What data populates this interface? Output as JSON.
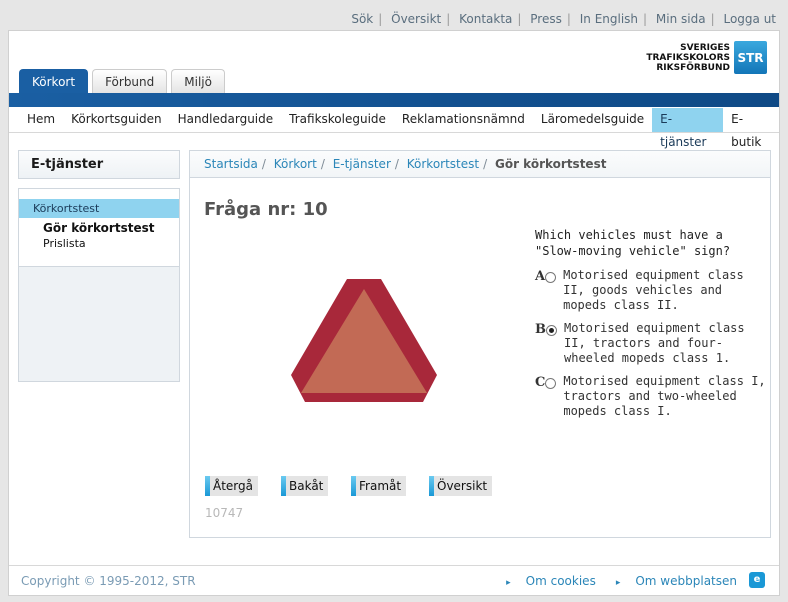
{
  "top_links": [
    "Sök",
    "Översikt",
    "Kontakta",
    "Press",
    "In English",
    "Min sida",
    "Logga ut"
  ],
  "header": {
    "tabs": [
      {
        "label": "Körkort",
        "active": true
      },
      {
        "label": "Förbund",
        "active": false
      },
      {
        "label": "Miljö",
        "active": false
      }
    ],
    "logo_line1": "SVERIGES",
    "logo_line2": "TRAFIKSKOLORS",
    "logo_line3": "RIKSFÖRBUND",
    "logo_abbr": "STR"
  },
  "nav": [
    {
      "label": "Hem",
      "active": false
    },
    {
      "label": "Körkortsguiden",
      "active": false
    },
    {
      "label": "Handledarguide",
      "active": false
    },
    {
      "label": "Trafikskoleguide",
      "active": false
    },
    {
      "label": "Reklamationsnämnd",
      "active": false
    },
    {
      "label": "Läromedelsguide",
      "active": false
    },
    {
      "label": "E-tjänster",
      "active": true
    },
    {
      "label": "E-butik",
      "active": false
    }
  ],
  "sidebar": {
    "title": "E-tjänster",
    "selected": "Körkortstest",
    "sub_active": "Gör körkortstest",
    "sub_item": "Prislista"
  },
  "breadcrumb": {
    "items": [
      "Startsida",
      "Körkort",
      "E-tjänster",
      "Körkortstest"
    ],
    "current": "Gör körkortstest"
  },
  "quiz": {
    "title": "Fråga nr: 10",
    "question": "Which vehicles must have a \"Slow-moving vehicle\" sign?",
    "answers": [
      {
        "letter": "A",
        "text": "Motorised equipment class II, goods vehicles and mopeds class II.",
        "selected": false
      },
      {
        "letter": "B",
        "text": "Motorised equipment class II, tractors and four-wheeled mopeds class 1.",
        "selected": true
      },
      {
        "letter": "C",
        "text": "Motorised equipment class I, tractors and two-wheeled mopeds class I.",
        "selected": false
      }
    ],
    "buttons": [
      "Återgå",
      "Bakåt",
      "Framåt",
      "Översikt"
    ],
    "code": "10747"
  },
  "footer": {
    "copyright": "Copyright © 1995-2012, STR",
    "links": [
      "Om cookies",
      "Om webbplatsen"
    ]
  },
  "colors": {
    "brand_blue": "#1a5fa3",
    "nav_active": "#8fd3ef",
    "link": "#2b86b8",
    "sign_border": "#a8283a",
    "sign_fill": "#c26a55"
  }
}
